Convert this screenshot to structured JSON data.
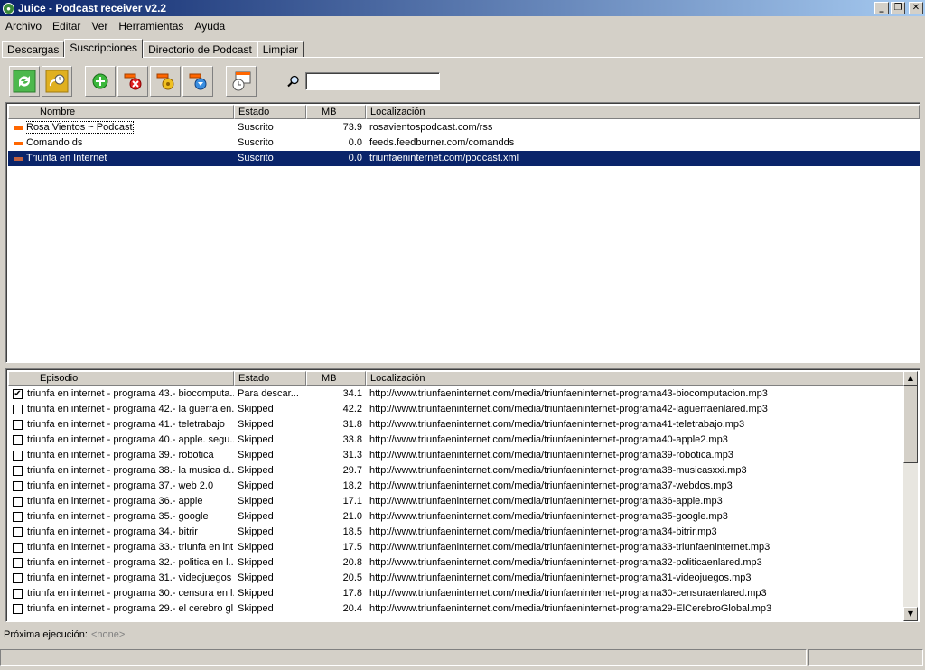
{
  "window": {
    "title": "Juice - Podcast receiver v2.2"
  },
  "menu": [
    "Archivo",
    "Editar",
    "Ver",
    "Herramientas",
    "Ayuda"
  ],
  "tabs": [
    {
      "label": "Descargas",
      "active": false
    },
    {
      "label": "Suscripciones",
      "active": true
    },
    {
      "label": "Directorio de Podcast",
      "active": false
    },
    {
      "label": "Limpiar",
      "active": false
    }
  ],
  "toolbar": {
    "buttons": [
      "check-now-icon",
      "scheduler-icon",
      "add-feed-icon",
      "remove-feed-icon",
      "feed-properties-icon",
      "feed-filter-icon",
      "catch-up-icon"
    ],
    "search_value": ""
  },
  "subscriptions": {
    "columns": [
      "Nombre",
      "Estado",
      "MB",
      "Localización"
    ],
    "rows": [
      {
        "name": "Rosa Vientos ~ Podcast",
        "status": "Suscrito",
        "mb": "73.9",
        "location": "rosavientospodcast.com/rss"
      },
      {
        "name": "Comando ds",
        "status": "Suscrito",
        "mb": "0.0",
        "location": "feeds.feedburner.com/comandds"
      },
      {
        "name": "Triunfa en Internet",
        "status": "Suscrito",
        "mb": "0.0",
        "location": "triunfaeninternet.com/podcast.xml"
      }
    ]
  },
  "episodes": {
    "columns": [
      "Episodio",
      "Estado",
      "MB",
      "Localización"
    ],
    "rows": [
      {
        "checked": true,
        "name": "triunfa en internet - programa 43.- biocomputa...",
        "status": "Para descar...",
        "mb": "34.1",
        "location": "http://www.triunfaeninternet.com/media/triunfaeninternet-programa43-biocomputacion.mp3"
      },
      {
        "checked": false,
        "name": "triunfa en internet - programa 42.- la guerra en...",
        "status": "Skipped",
        "mb": "42.2",
        "location": "http://www.triunfaeninternet.com/media/triunfaeninternet-programa42-laguerraenlared.mp3"
      },
      {
        "checked": false,
        "name": "triunfa en internet - programa 41.- teletrabajo",
        "status": "Skipped",
        "mb": "31.8",
        "location": "http://www.triunfaeninternet.com/media/triunfaeninternet-programa41-teletrabajo.mp3"
      },
      {
        "checked": false,
        "name": "triunfa en internet - programa 40.- apple. segu...",
        "status": "Skipped",
        "mb": "33.8",
        "location": "http://www.triunfaeninternet.com/media/triunfaeninternet-programa40-apple2.mp3"
      },
      {
        "checked": false,
        "name": "triunfa en internet - programa 39.- robotica",
        "status": "Skipped",
        "mb": "31.3",
        "location": "http://www.triunfaeninternet.com/media/triunfaeninternet-programa39-robotica.mp3"
      },
      {
        "checked": false,
        "name": "triunfa en internet - programa 38.- la musica d...",
        "status": "Skipped",
        "mb": "29.7",
        "location": "http://www.triunfaeninternet.com/media/triunfaeninternet-programa38-musicasxxi.mp3"
      },
      {
        "checked": false,
        "name": "triunfa en internet - programa 37.- web 2.0",
        "status": "Skipped",
        "mb": "18.2",
        "location": "http://www.triunfaeninternet.com/media/triunfaeninternet-programa37-webdos.mp3"
      },
      {
        "checked": false,
        "name": "triunfa en internet - programa 36.- apple",
        "status": "Skipped",
        "mb": "17.1",
        "location": "http://www.triunfaeninternet.com/media/triunfaeninternet-programa36-apple.mp3"
      },
      {
        "checked": false,
        "name": "triunfa en internet - programa 35.- google",
        "status": "Skipped",
        "mb": "21.0",
        "location": "http://www.triunfaeninternet.com/media/triunfaeninternet-programa35-google.mp3"
      },
      {
        "checked": false,
        "name": "triunfa en internet - programa 34.- bitrir",
        "status": "Skipped",
        "mb": "18.5",
        "location": "http://www.triunfaeninternet.com/media/triunfaeninternet-programa34-bitrir.mp3"
      },
      {
        "checked": false,
        "name": "triunfa en internet - programa 33.- triunfa en int...",
        "status": "Skipped",
        "mb": "17.5",
        "location": "http://www.triunfaeninternet.com/media/triunfaeninternet-programa33-triunfaeninternet.mp3"
      },
      {
        "checked": false,
        "name": "triunfa en internet - programa 32.- politica en l...",
        "status": "Skipped",
        "mb": "20.8",
        "location": "http://www.triunfaeninternet.com/media/triunfaeninternet-programa32-politicaenlared.mp3"
      },
      {
        "checked": false,
        "name": "triunfa en internet - programa 31.- videojuegos",
        "status": "Skipped",
        "mb": "20.5",
        "location": "http://www.triunfaeninternet.com/media/triunfaeninternet-programa31-videojuegos.mp3"
      },
      {
        "checked": false,
        "name": "triunfa en internet - programa 30.- censura en l...",
        "status": "Skipped",
        "mb": "17.8",
        "location": "http://www.triunfaeninternet.com/media/triunfaeninternet-programa30-censuraenlared.mp3"
      },
      {
        "checked": false,
        "name": "triunfa en internet - programa 29.- el cerebro gl...",
        "status": "Skipped",
        "mb": "20.4",
        "location": "http://www.triunfaeninternet.com/media/triunfaeninternet-programa29-ElCerebroGlobal.mp3"
      }
    ]
  },
  "next_run": {
    "label": "Próxima ejecución:",
    "value": "<none>"
  },
  "colors": {
    "selection": "#0a246a",
    "title_start": "#0a246a",
    "title_end": "#a6caf0",
    "feed_icon": "#ff6600"
  }
}
